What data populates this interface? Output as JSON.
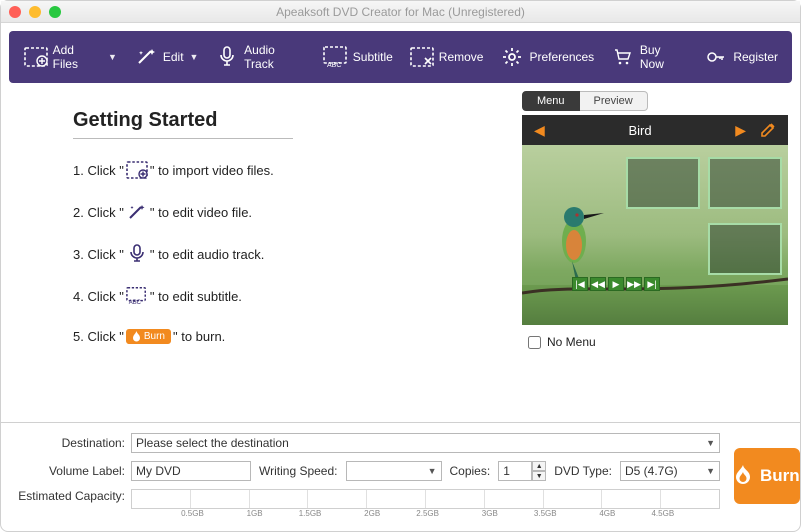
{
  "window": {
    "title": "Apeaksoft DVD Creator for Mac (Unregistered)"
  },
  "toolbar": {
    "add_files": "Add Files",
    "edit": "Edit",
    "audio_track": "Audio Track",
    "subtitle": "Subtitle",
    "remove": "Remove",
    "preferences": "Preferences",
    "buy_now": "Buy Now",
    "register": "Register"
  },
  "getting_started": {
    "title": "Getting Started",
    "steps": {
      "s1a": "1. Click \" ",
      "s1b": " \" to import video files.",
      "s2a": "2. Click \" ",
      "s2b": " \" to edit video file.",
      "s3a": "3. Click \" ",
      "s3b": " \" to edit audio track.",
      "s4a": "4. Click \" ",
      "s4b": " \" to edit subtitle.",
      "s5a": "5. Click \" ",
      "s5b": " \" to burn.",
      "burn_chip": "Burn"
    }
  },
  "preview": {
    "tab_menu": "Menu",
    "tab_preview": "Preview",
    "menu_title": "Bird",
    "no_menu": "No Menu"
  },
  "bottom": {
    "destination_label": "Destination:",
    "destination_value": "Please select the destination",
    "volume_label": "Volume Label:",
    "volume_value": "My DVD",
    "writing_speed_label": "Writing Speed:",
    "writing_speed_value": "",
    "copies_label": "Copies:",
    "copies_value": "1",
    "dvd_type_label": "DVD Type:",
    "dvd_type_value": "D5 (4.7G)",
    "capacity_label": "Estimated Capacity:",
    "ticks": [
      "0.5GB",
      "1GB",
      "1.5GB",
      "2GB",
      "2.5GB",
      "3GB",
      "3.5GB",
      "4GB",
      "4.5GB"
    ],
    "burn": "Burn"
  }
}
